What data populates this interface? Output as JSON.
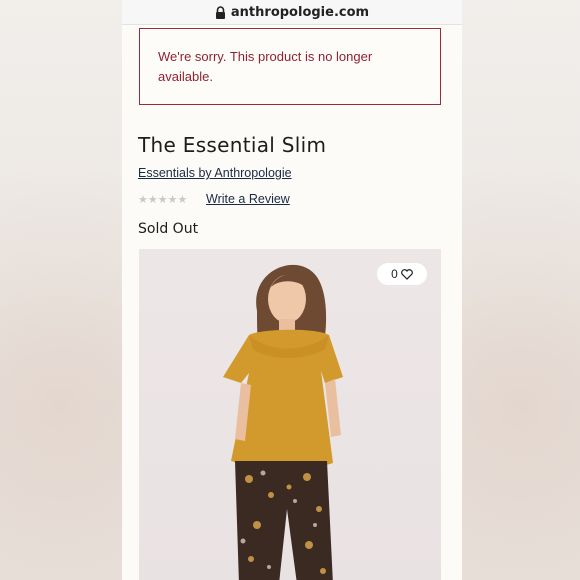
{
  "browser": {
    "url": "anthropologie.com"
  },
  "alert": {
    "message": "We're sorry. This product is no longer available."
  },
  "product": {
    "title": "The Essential Slim",
    "brand_link": "Essentials by Anthropologie",
    "rating_stars": "★★★★★",
    "write_review": "Write a Review",
    "availability": "Sold Out",
    "favorites_count": "0"
  },
  "icons": {
    "lock": "lock-icon",
    "heart": "heart-icon"
  },
  "colors": {
    "alert_red": "#8e2233",
    "link_navy": "#1b2a45",
    "top_mustard": "#d29a2c"
  }
}
